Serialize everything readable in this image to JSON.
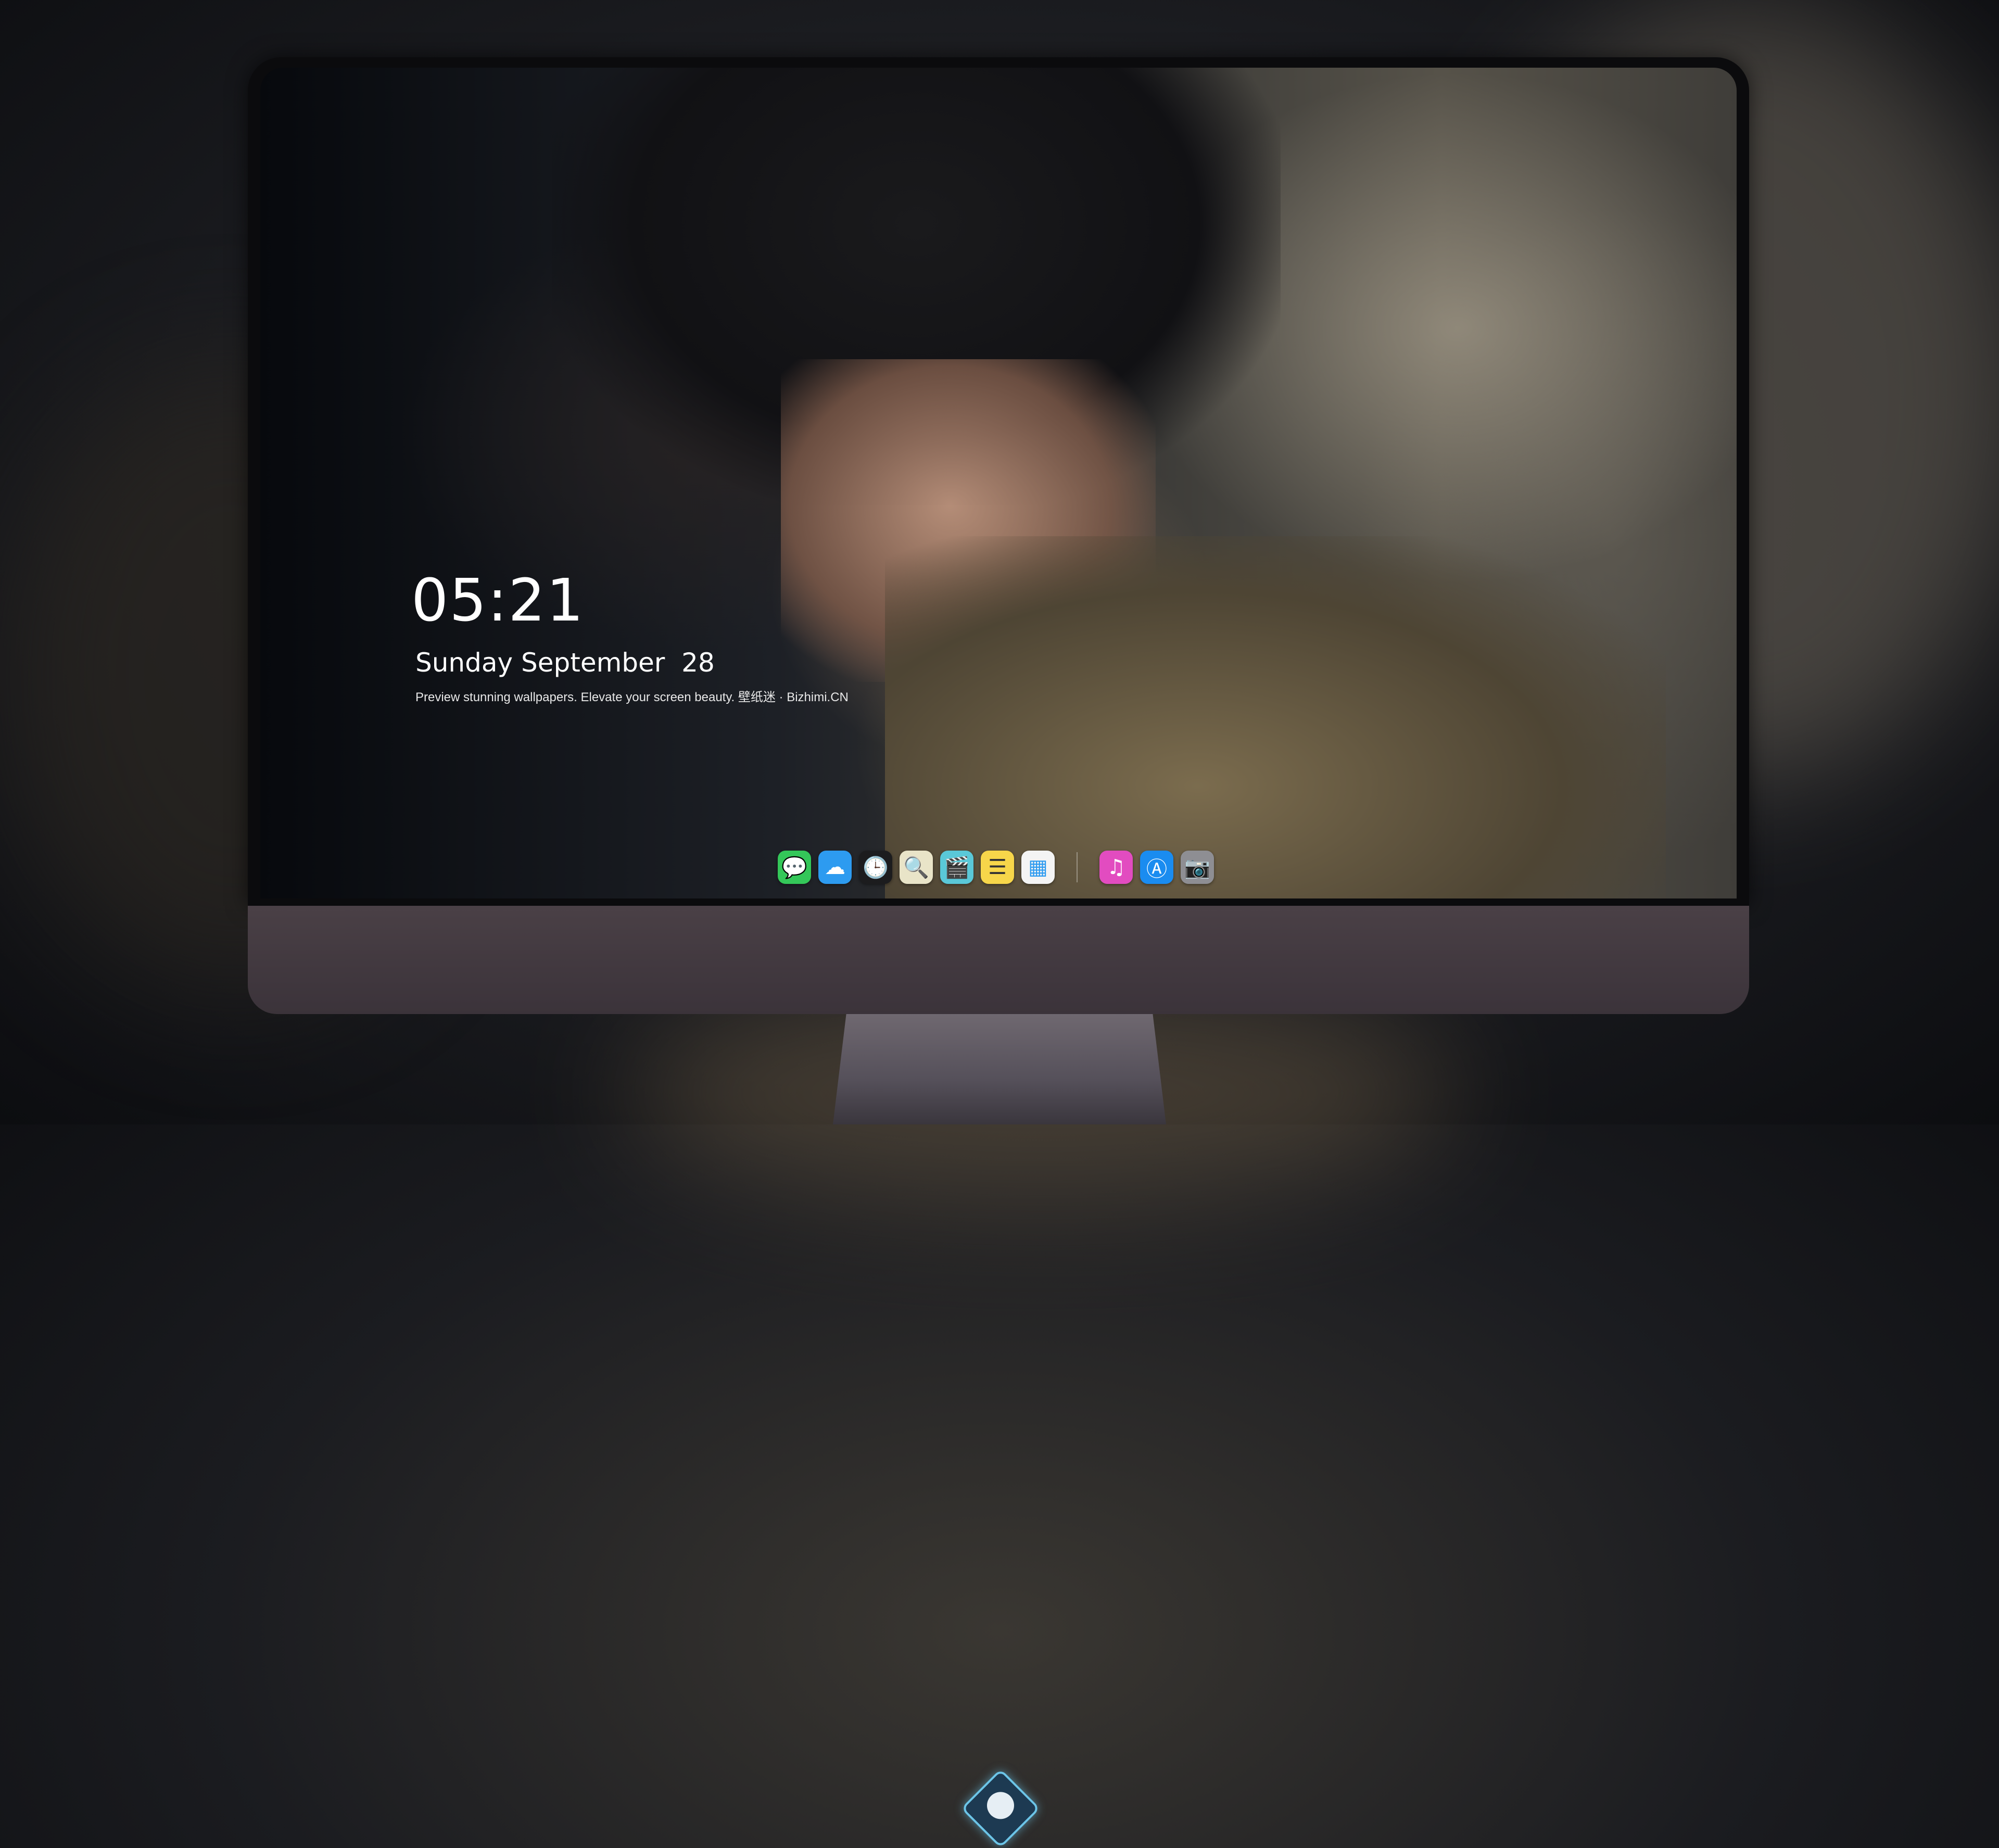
{
  "lockscreen": {
    "time": "05:21",
    "date": "Sunday September  28",
    "tagline": "Preview stunning wallpapers. Elevate your screen beauty. 壁纸迷 · Bizhimi.CN"
  },
  "dock": {
    "apps": [
      {
        "name": "messages-icon",
        "glyph": "💬",
        "color": "#34c759"
      },
      {
        "name": "weather-icon",
        "glyph": "☁",
        "color": "#2d9bf0"
      },
      {
        "name": "clock-icon",
        "glyph": "🕒",
        "color": "#1c1c1e"
      },
      {
        "name": "preview-icon",
        "glyph": "🔍",
        "color": "#e9e4c8"
      },
      {
        "name": "clapperboard-icon",
        "glyph": "🎬",
        "color": "#5ac8d8"
      },
      {
        "name": "notes-icon",
        "glyph": "☰",
        "color": "#f7d64a"
      },
      {
        "name": "photos-icon",
        "glyph": "▦",
        "color": "#f4f4f4"
      },
      {
        "name": "music-icon",
        "glyph": "♫",
        "color": "#e24cc0"
      },
      {
        "name": "app-store-icon",
        "glyph": "Ⓐ",
        "color": "#1a8cf0"
      },
      {
        "name": "camera-icon",
        "glyph": "📷",
        "color": "#8e8e93"
      }
    ]
  },
  "colors": {
    "bezel": "#0b0b0d",
    "chin": "#4a4046",
    "logo_accent": "#6cc5e8"
  }
}
